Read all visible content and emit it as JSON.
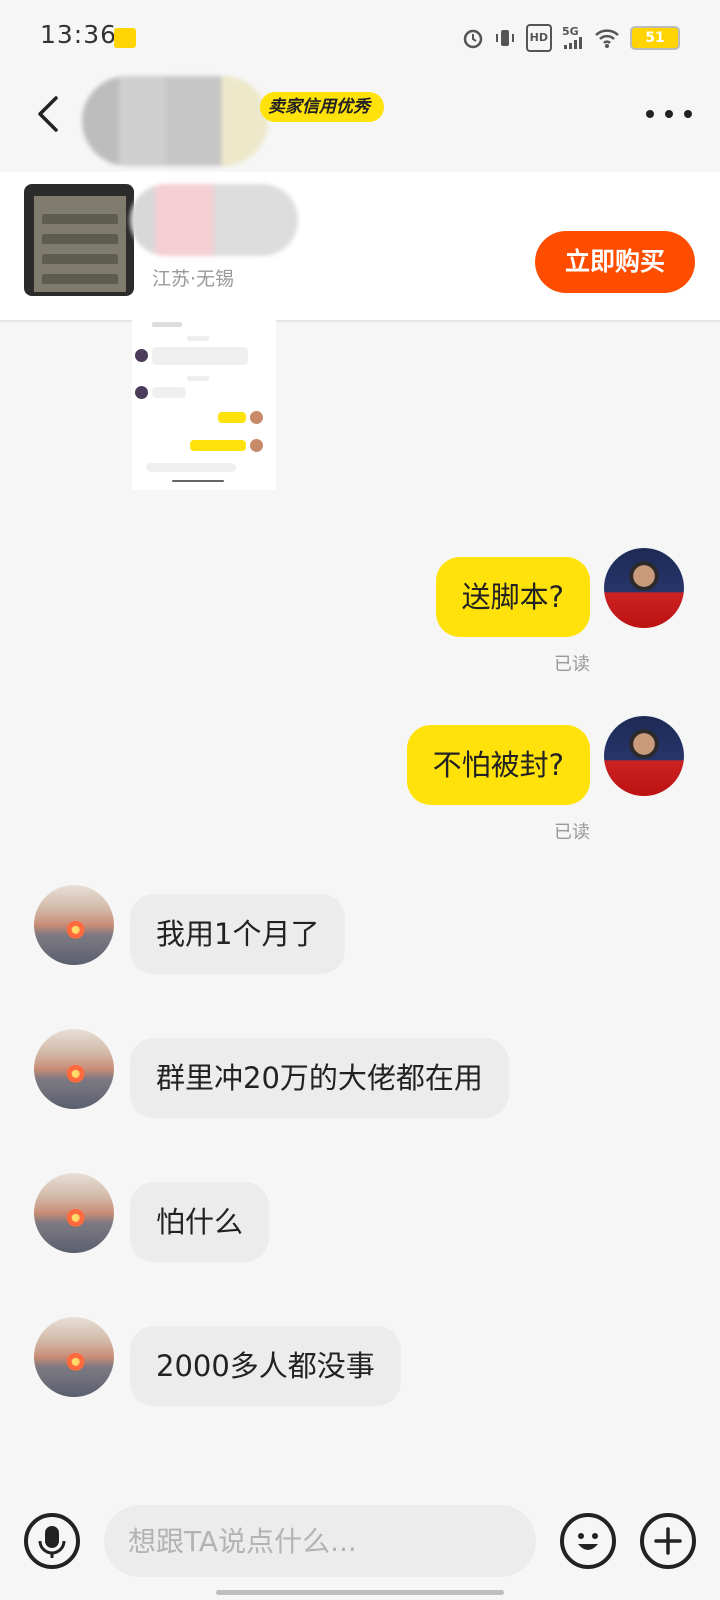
{
  "status_bar": {
    "time": "13:36",
    "network": "5G",
    "hd": "HD",
    "battery": "51"
  },
  "header": {
    "credit_badge": "卖家信用优秀"
  },
  "product": {
    "location": "江苏·无锡",
    "buy_label": "立即购买"
  },
  "messages": [
    {
      "side": "me",
      "text": "送脚本?",
      "status": "已读"
    },
    {
      "side": "me",
      "text": "不怕被封?",
      "status": "已读"
    },
    {
      "side": "them",
      "text": "我用1个月了"
    },
    {
      "side": "them",
      "text": "群里冲20万的大佬都在用"
    },
    {
      "side": "them",
      "text": "怕什么"
    },
    {
      "side": "them",
      "text": "2000多人都没事"
    }
  ],
  "input": {
    "placeholder": "想跟TA说点什么..."
  },
  "colors": {
    "accent_yellow": "#ffe20a",
    "buy_orange": "#ff4d00"
  },
  "icons": [
    "back-arrow-icon",
    "more-icon",
    "microphone-icon",
    "emoji-icon",
    "plus-icon",
    "alarm-icon",
    "vibrate-icon",
    "wifi-icon",
    "battery-icon"
  ]
}
